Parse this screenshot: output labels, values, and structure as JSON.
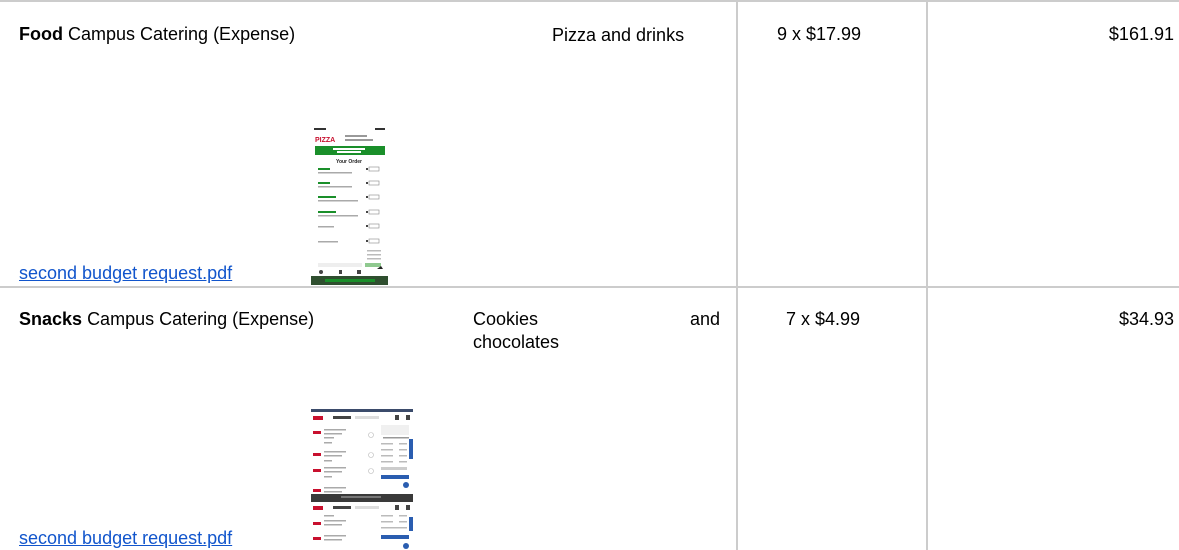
{
  "rows": [
    {
      "category": "Food",
      "vendor": "Campus Catering (Expense)",
      "description": "Pizza and drinks",
      "quantity": "9 x $17.99",
      "total": "$161.91",
      "attachment_link": "second budget request.pdf",
      "thumbnail": {
        "type": "mobile-order-screenshot",
        "brand": "PIZZA",
        "banner": "Welcome! Sign in for rewards",
        "heading": "Your Order"
      }
    },
    {
      "category": "Snacks",
      "vendor": "Campus Catering (Expense)",
      "description_line1_a": "Cookies",
      "description_line1_b": "and",
      "description_line2": "chocolates",
      "quantity": "7 x $4.99",
      "total": "$34.93",
      "attachment_link": "second budget request.pdf",
      "thumbnail": {
        "type": "web-cart-screenshot"
      }
    }
  ],
  "colors": {
    "grid": "#cccccc",
    "link": "#1155cc",
    "thumb_green": "#1a8f2a",
    "thumb_dark": "#2f4f2f",
    "thumb_red": "#c8102e",
    "thumb_blue": "#2a5db0"
  }
}
